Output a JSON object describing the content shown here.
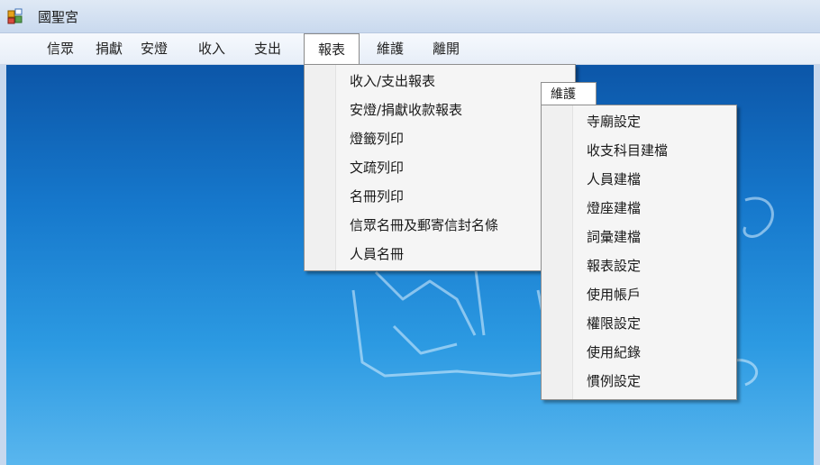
{
  "window": {
    "title": "國聖宮"
  },
  "menubar": {
    "items": [
      "信眾",
      "捐獻",
      "安燈",
      "收入",
      "支出",
      "報表",
      "維護",
      "離開"
    ],
    "active": "報表"
  },
  "report_menu": {
    "items": [
      "收入/支出報表",
      "安燈/捐獻收款報表",
      "燈籤列印",
      "文疏列印",
      "名冊列印",
      "信眾名冊及郵寄信封名條",
      "人員名冊"
    ]
  },
  "maintenance_menu": {
    "header": "維護",
    "items": [
      "寺廟設定",
      "收支科目建檔",
      "人員建檔",
      "燈座建檔",
      "詞彙建檔",
      "報表設定",
      "使用帳戶",
      "權限設定",
      "使用紀錄",
      "慣例設定"
    ]
  },
  "colors": {
    "desktop_top": "#0c56a8",
    "desktop_bottom": "#59b6ee",
    "menu_bg": "#f5f5f5"
  }
}
